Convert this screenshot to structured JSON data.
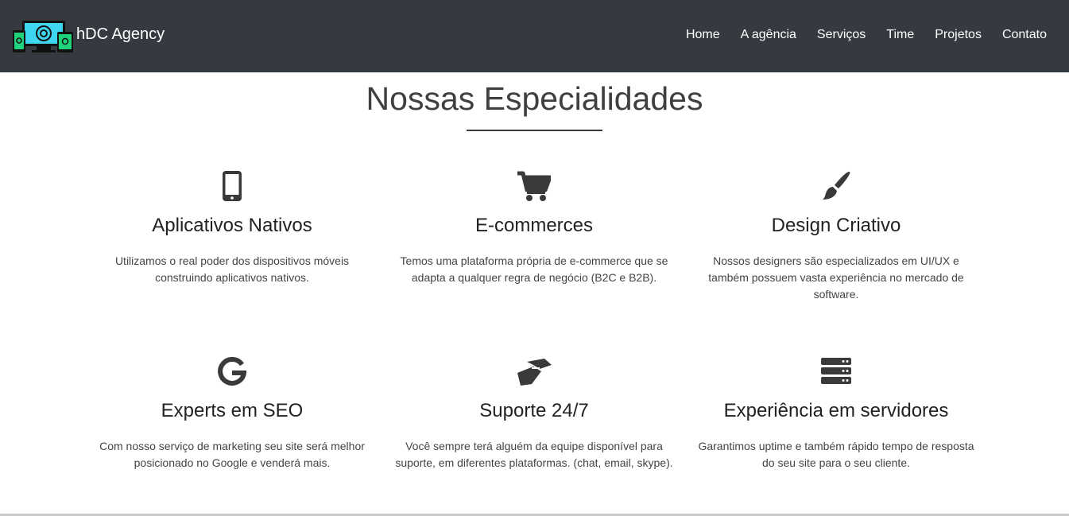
{
  "navbar": {
    "brand": "hDC Agency",
    "logo_icon": "devices-logo-icon",
    "links": [
      "Home",
      "A agência",
      "Serviços",
      "Time",
      "Projetos",
      "Contato"
    ],
    "background": "#343a40"
  },
  "section": {
    "title": "Nossas Especialidades"
  },
  "features": [
    {
      "icon": "mobile-phone-icon",
      "title": "Aplicativos Nativos",
      "text_lines": [
        "Utilizamos o real poder dos dispositivos móveis",
        "construindo aplicativos nativos."
      ]
    },
    {
      "icon": "shopping-cart-icon",
      "title": "E-commerces",
      "text_lines": [
        "Temos uma plataforma própria de e-commerce que se",
        "adapta a qualquer regra de negócio (B2C e B2B)."
      ]
    },
    {
      "icon": "paint-brush-icon",
      "title": "Design Criativo",
      "text_lines": [
        "Nossos designers são especializados em UI/UX e",
        "também possuem vasta experiência no mercado de",
        "software."
      ]
    },
    {
      "icon": "google-icon",
      "title": "Experts em SEO",
      "text_lines": [
        "Com nosso serviço de marketing seu site será melhor",
        "posicionado no Google e venderá mais."
      ]
    },
    {
      "icon": "handshake-icon",
      "title": "Suporte 24/7",
      "text_lines": [
        "Você sempre terá alguém da equipe disponível para",
        "suporte, em diferentes plataformas. (chat, email, skype)."
      ]
    },
    {
      "icon": "server-icon",
      "title": "Experiência em servidores",
      "text_lines": [
        "Garantimos uptime e também rápido tempo de resposta",
        "do seu site para o seu cliente."
      ]
    }
  ],
  "colors": {
    "icon": "#3a3a3a",
    "logo_accent": "#3fd7f0",
    "logo_green": "#1fd17a"
  }
}
